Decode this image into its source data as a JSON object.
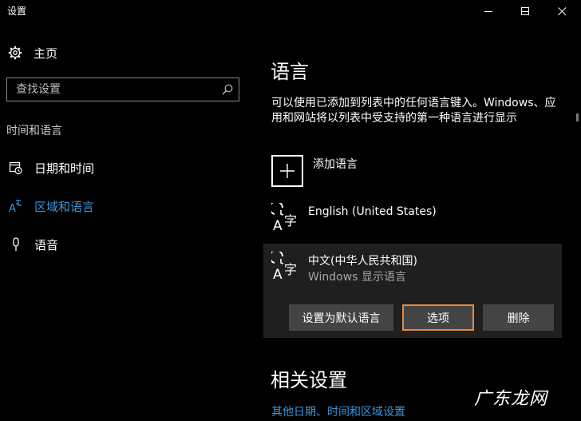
{
  "window": {
    "title": "设置",
    "controls": [
      "minimize-icon",
      "maximize-icon",
      "close-icon"
    ]
  },
  "sidebar": {
    "home_label": "主页",
    "home_icon": "gear-icon",
    "search": {
      "placeholder": "查找设置",
      "icon": "search-icon"
    },
    "group_header": "时间和语言",
    "items": [
      {
        "label": "日期和时间",
        "icon": "calendar-clock-icon",
        "active": false
      },
      {
        "label": "区域和语言",
        "icon": "region-language-icon",
        "active": true
      },
      {
        "label": "语音",
        "icon": "microphone-icon",
        "active": false
      }
    ]
  },
  "main": {
    "title": "语言",
    "description": "可以使用已添加到列表中的任何语言键入。Windows、应用和网站将以列表中受支持的第一种语言进行显示",
    "add_language_label": "添加语言",
    "languages": [
      {
        "name": "English (United States)",
        "subtitle": "",
        "icon": "language-icon"
      },
      {
        "name": "中文(中华人民共和国)",
        "subtitle": "Windows 显示语言",
        "icon": "language-icon"
      }
    ],
    "buttons": {
      "set_default": "设置为默认语言",
      "options": "选项",
      "remove": "删除"
    },
    "related_title": "相关设置",
    "related_link": "其他日期、时间和区域设置"
  },
  "watermark": "广东龙网",
  "colors": {
    "background": "#000000",
    "accent": "#3a96dd",
    "focus_border": "#e58a3c",
    "button_bg": "#444444",
    "selected_row_bg": "#1f1f1f"
  }
}
